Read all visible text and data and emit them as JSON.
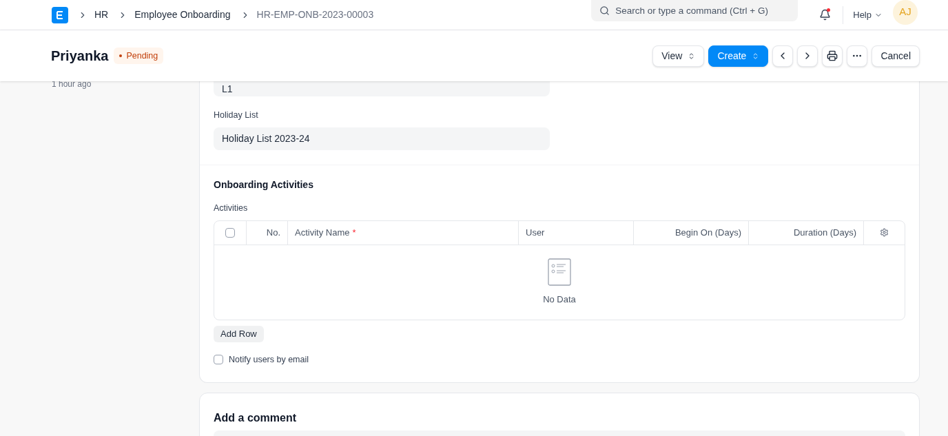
{
  "navbar": {
    "breadcrumbs": [
      "HR",
      "Employee Onboarding",
      "HR-EMP-ONB-2023-00003"
    ],
    "search": {
      "placeholder": "Search or type a command (Ctrl + G)"
    },
    "notifications_unread": true,
    "help": "Help",
    "avatar": "AJ"
  },
  "title_bar": {
    "title": "Priyanka",
    "status": "Pending",
    "buttons": [
      {
        "kind": "select",
        "label": "View"
      },
      {
        "kind": "primary",
        "label": "Create"
      },
      {
        "kind": "prev"
      },
      {
        "kind": "next"
      },
      {
        "kind": "print"
      },
      {
        "kind": "more"
      },
      {
        "kind": "plain",
        "label": "Cancel"
      }
    ]
  },
  "sidebar": {
    "modified": "1 hour ago"
  },
  "form": {
    "fields": [
      {
        "value": "L1"
      },
      {
        "label": "Holiday List",
        "value": "Holiday List 2023-24"
      }
    ],
    "section": {
      "title": "Onboarding Activities",
      "table_label": "Activities",
      "columns": [
        {
          "kind": "check",
          "checked": false
        },
        {
          "kind": "number",
          "label": "No."
        },
        {
          "kind": "text",
          "label": "Activity Name",
          "required_mark": "*"
        },
        {
          "kind": "text",
          "label": "User"
        },
        {
          "kind": "number",
          "label": "Begin On (Days)"
        },
        {
          "kind": "number",
          "label": "Duration (Days)"
        },
        {
          "kind": "settings"
        }
      ],
      "empty_text": "No Data",
      "add_row": "Add Row",
      "notify": {
        "label": "Notify users by email",
        "checked": false
      }
    }
  },
  "comment": {
    "title": "Add a comment"
  }
}
